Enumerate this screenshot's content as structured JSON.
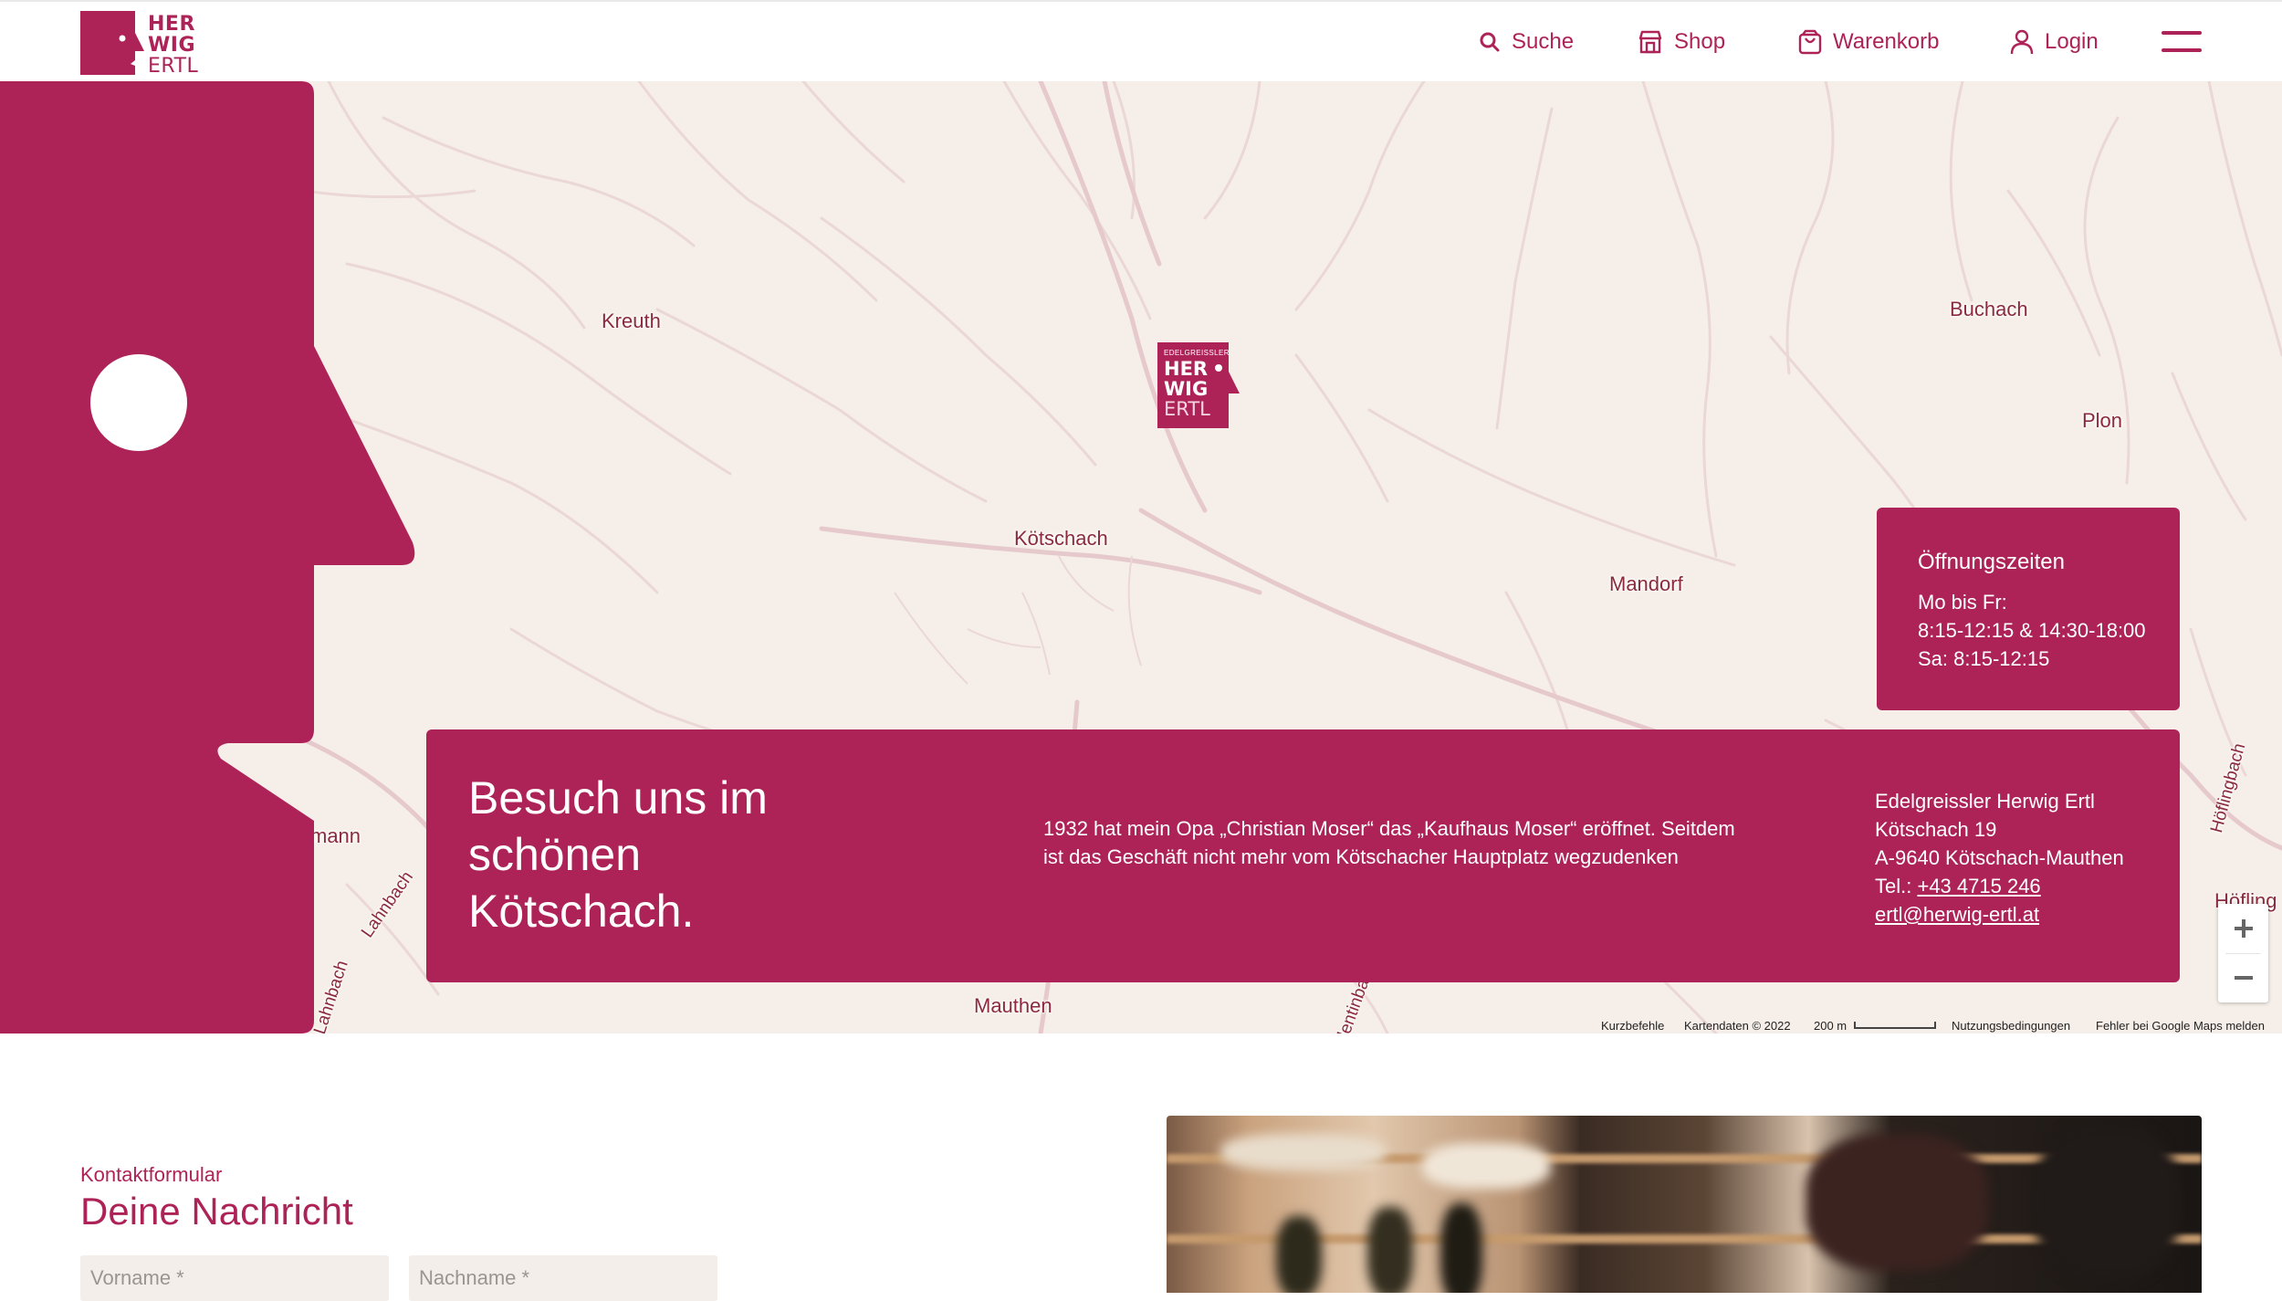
{
  "header": {
    "logo_lines": [
      "HER",
      "WIG",
      "ERTL"
    ],
    "nav": [
      {
        "label": "Suche",
        "icon": "search-icon"
      },
      {
        "label": "Shop",
        "icon": "shop-icon"
      },
      {
        "label": "Warenkorb",
        "icon": "cart-icon"
      },
      {
        "label": "Login",
        "icon": "user-icon"
      }
    ],
    "menu_icon": "hamburger-icon"
  },
  "map": {
    "places": [
      "Kreuth",
      "Buchach",
      "Plon",
      "Kötschach",
      "Mandorf",
      "mann",
      "Lahnbach",
      "Lahnbach",
      "Mauthen",
      "Höflingbach",
      "Höfling",
      "lentinba"
    ],
    "marker": {
      "small": "EDELGREISSLER",
      "lines": [
        "HER",
        "WIG",
        "ERTL"
      ]
    },
    "zoom_in": "+",
    "zoom_out": "−",
    "attribution": {
      "shortcuts": "Kurzbefehle",
      "data": "Kartendaten © 2022",
      "scale": "200 m",
      "terms": "Nutzungsbedingungen",
      "report": "Fehler bei Google Maps melden"
    }
  },
  "hours": {
    "title": "Öffnungszeiten",
    "lines": [
      "Mo bis Fr:",
      "8:15-12:15 & 14:30-18:00",
      "Sa: 8:15-12:15"
    ]
  },
  "visit": {
    "heading": [
      "Besuch uns im",
      "schönen",
      "Kötschach."
    ],
    "text": "1932 hat mein Opa „Christian Moser“ das „Kaufhaus Moser“ eröffnet. Seitdem ist das Geschäft nicht mehr vom Kötschacher Hauptplatz wegzudenken",
    "contact": {
      "name": "Edelgreissler Herwig Ertl",
      "street": "Kötschach 19",
      "city": "A-9640 Kötschach-Mauthen",
      "tel_label": "Tel.: ",
      "tel": "+43 4715 246",
      "email": "ertl@herwig-ertl.at"
    }
  },
  "contact_form": {
    "label": "Kontaktformular",
    "title": "Deine Nachricht",
    "first_name_placeholder": "Vorname *",
    "last_name_placeholder": "Nachname *"
  },
  "colors": {
    "brand": "#AE2357",
    "map_background": "#f6efe9"
  }
}
